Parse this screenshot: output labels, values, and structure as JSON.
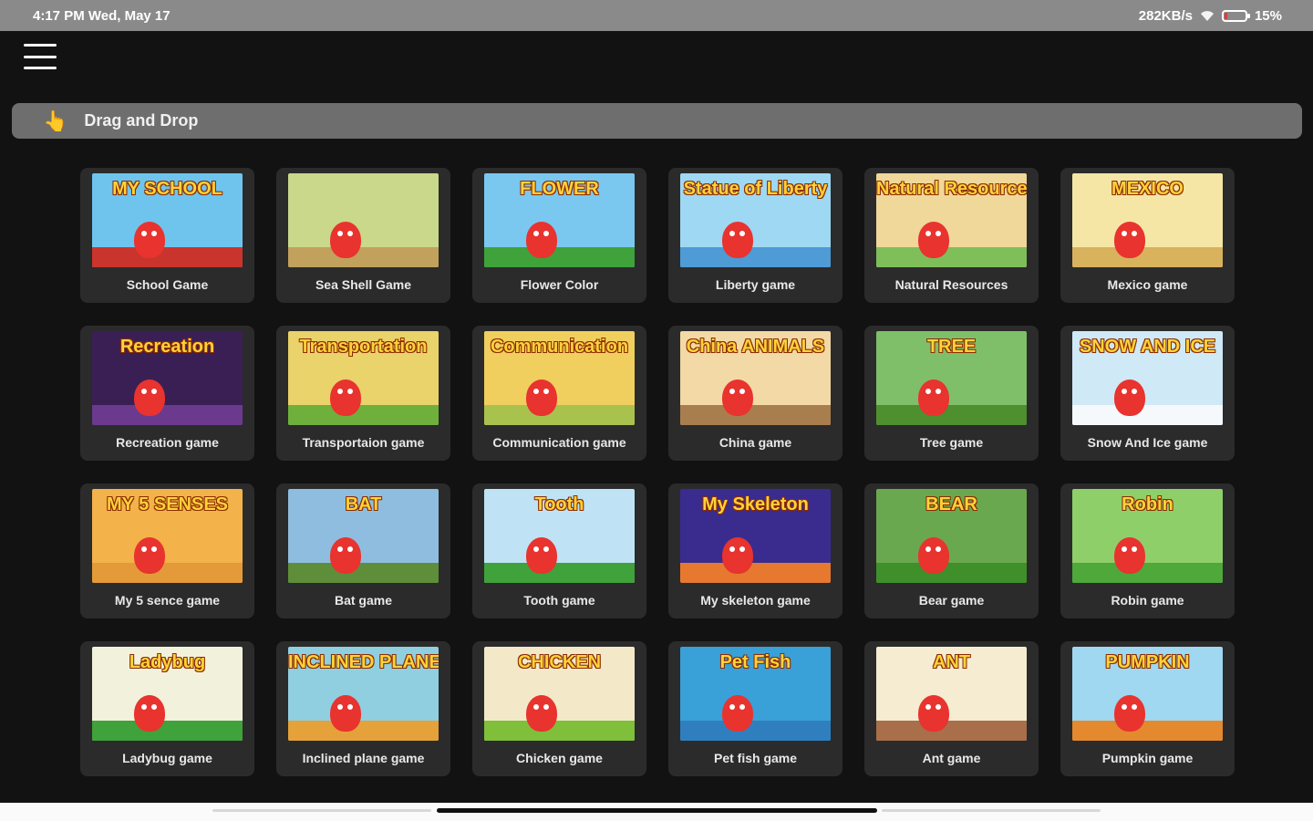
{
  "status_bar": {
    "time_date": "4:17 PM Wed, May 17",
    "network_speed": "282KB/s",
    "battery_percent": "15%",
    "battery_level": 0.15,
    "battery_color": "#e53935"
  },
  "header": {
    "menu_icon": "hamburger-menu-icon"
  },
  "mode_bar": {
    "icon": "pointing-hand-icon",
    "icon_glyph": "👆",
    "label": "Drag and Drop"
  },
  "games": [
    {
      "label": "School Game",
      "banner": "MY SCHOOL",
      "sky": "#6fc4ee",
      "ground": "#c9342c"
    },
    {
      "label": "Sea Shell Game",
      "banner": "",
      "sky": "#c9d88a",
      "ground": "#c2a15c"
    },
    {
      "label": "Flower Color",
      "banner": "FLOWER",
      "sky": "#7ac8f0",
      "ground": "#3fa23a"
    },
    {
      "label": "Liberty game",
      "banner": "Statue of Liberty",
      "sky": "#9fd8f2",
      "ground": "#4e9bd6"
    },
    {
      "label": "Natural Resources",
      "banner": "Natural Resources",
      "sky": "#f0d79a",
      "ground": "#7fbf5a"
    },
    {
      "label": "Mexico game",
      "banner": "MEXICO",
      "sky": "#f5e6a6",
      "ground": "#d8b25c"
    },
    {
      "label": "Recreation game",
      "banner": "Recreation",
      "sky": "#3a1f55",
      "ground": "#6b3a8f"
    },
    {
      "label": "Transportaion game",
      "banner": "Transportation",
      "sky": "#e9d36a",
      "ground": "#6fb03c"
    },
    {
      "label": "Communication game",
      "banner": "Communication",
      "sky": "#f0cf5e",
      "ground": "#a9c24e"
    },
    {
      "label": "China game",
      "banner": "China ANIMALS",
      "sky": "#f3d9a6",
      "ground": "#a87e4f"
    },
    {
      "label": "Tree game",
      "banner": "TREE",
      "sky": "#7fbf6a",
      "ground": "#4e8f2f"
    },
    {
      "label": "Snow And Ice game",
      "banner": "SNOW AND ICE",
      "sky": "#cfe9f7",
      "ground": "#f5f9fb"
    },
    {
      "label": "My 5 sence  game",
      "banner": "MY 5 SENSES",
      "sky": "#f3b24a",
      "ground": "#e59a3a"
    },
    {
      "label": "Bat game",
      "banner": "BAT",
      "sky": "#8fbde0",
      "ground": "#5f8e3a"
    },
    {
      "label": "Tooth game",
      "banner": "Tooth",
      "sky": "#bfe3f5",
      "ground": "#3fa23a"
    },
    {
      "label": "My skeleton game",
      "banner": "My Skeleton",
      "sky": "#3a2b8f",
      "ground": "#e6792f"
    },
    {
      "label": "Bear game",
      "banner": "BEAR",
      "sky": "#6aa84f",
      "ground": "#3f8f2a"
    },
    {
      "label": "Robin game",
      "banner": "Robin",
      "sky": "#8fcf6a",
      "ground": "#4ea83a"
    },
    {
      "label": "Ladybug game",
      "banner": "Ladybug",
      "sky": "#f2f2dc",
      "ground": "#3fa23a"
    },
    {
      "label": "Inclined plane game",
      "banner": "INCLINED PLANE",
      "sky": "#8fcfe0",
      "ground": "#e5a13a"
    },
    {
      "label": "Chicken game",
      "banner": "CHICKEN",
      "sky": "#f3e9c9",
      "ground": "#7fbf3a"
    },
    {
      "label": "Pet fish game",
      "banner": "Pet Fish",
      "sky": "#3aa0d8",
      "ground": "#2f7fbf"
    },
    {
      "label": "Ant game",
      "banner": "ANT",
      "sky": "#f5ecd2",
      "ground": "#a86f4a"
    },
    {
      "label": "Pumpkin game",
      "banner": "PUMPKIN",
      "sky": "#9fd8f0",
      "ground": "#e5892f"
    }
  ]
}
